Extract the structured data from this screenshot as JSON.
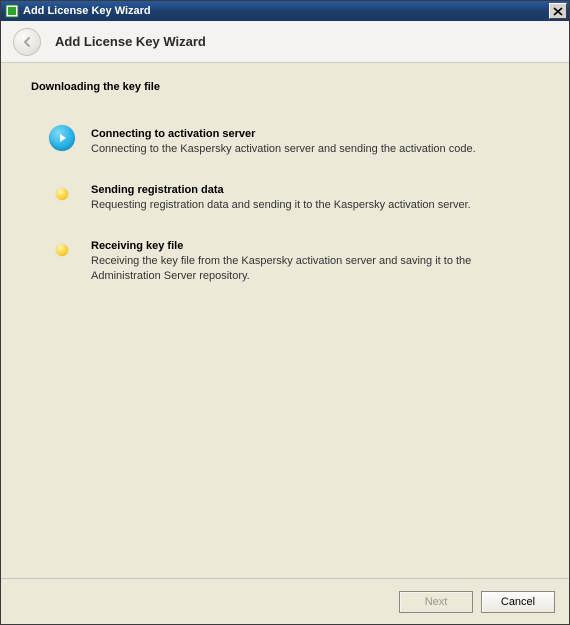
{
  "window": {
    "title": "Add License Key Wizard"
  },
  "header": {
    "title": "Add License Key Wizard"
  },
  "section": {
    "title": "Downloading the key file"
  },
  "steps": [
    {
      "status": "active",
      "title": "Connecting to activation server",
      "desc": "Connecting to the Kaspersky activation server and sending the activation code."
    },
    {
      "status": "pending",
      "title": "Sending registration data",
      "desc": "Requesting registration data and sending it to the Kaspersky activation server."
    },
    {
      "status": "pending",
      "title": "Receiving key file",
      "desc": "Receiving the key file from the Kaspersky activation server and saving it to the Administration Server repository."
    }
  ],
  "footer": {
    "next_label": "Next",
    "cancel_label": "Cancel",
    "next_enabled": false
  }
}
